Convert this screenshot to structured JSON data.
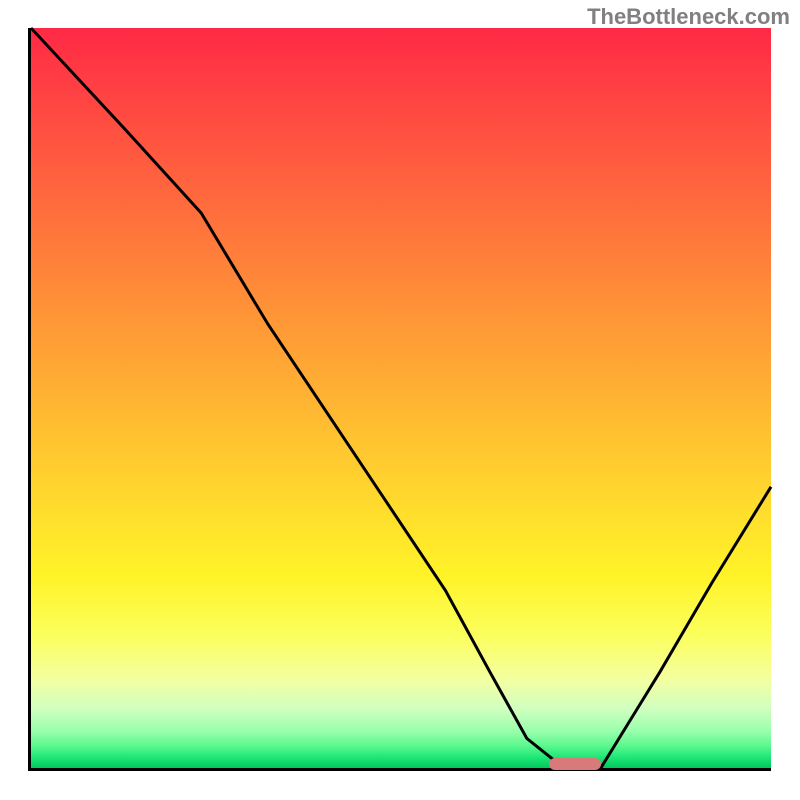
{
  "watermark": "TheBottleneck.com",
  "chart_data": {
    "type": "line",
    "title": "",
    "xlabel": "",
    "ylabel": "",
    "xlim": [
      0,
      100
    ],
    "ylim": [
      0,
      100
    ],
    "background": "red-to-green-vertical-gradient",
    "series": [
      {
        "name": "bottleneck-curve",
        "x": [
          0,
          13,
          23,
          32,
          44,
          56,
          62,
          67,
          72,
          77,
          85,
          92,
          100
        ],
        "values": [
          100,
          86,
          75,
          60,
          42,
          24,
          13,
          4,
          0,
          0,
          13,
          25,
          38
        ]
      }
    ],
    "marker": {
      "x_start": 70,
      "x_end": 77,
      "y": 0.5,
      "color": "#d97a7a"
    }
  }
}
